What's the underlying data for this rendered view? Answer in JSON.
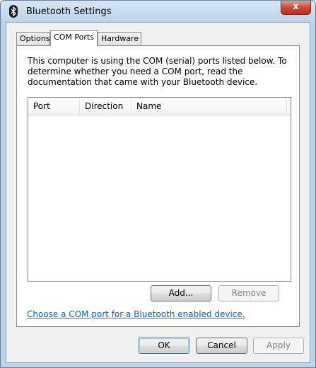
{
  "window": {
    "title": "Bluetooth Settings",
    "close_glyph": "x"
  },
  "tabs": [
    {
      "label": "Options"
    },
    {
      "label": "COM Ports"
    },
    {
      "label": "Hardware"
    }
  ],
  "panel": {
    "description": "This computer is using the COM (serial) ports listed below. To determine whether you need a COM port, read the documentation that came with your Bluetooth device.",
    "columns": [
      "Port",
      "Direction",
      "Name"
    ],
    "rows": [],
    "add_label": "Add...",
    "remove_label": "Remove"
  },
  "link_text": "Choose a COM port for a Bluetooth enabled device.",
  "footer": {
    "ok_label": "OK",
    "cancel_label": "Cancel",
    "apply_label": "Apply"
  },
  "colors": {
    "link": "#0066cc",
    "frame": "#bcd3ea",
    "close": "#c94b36"
  }
}
